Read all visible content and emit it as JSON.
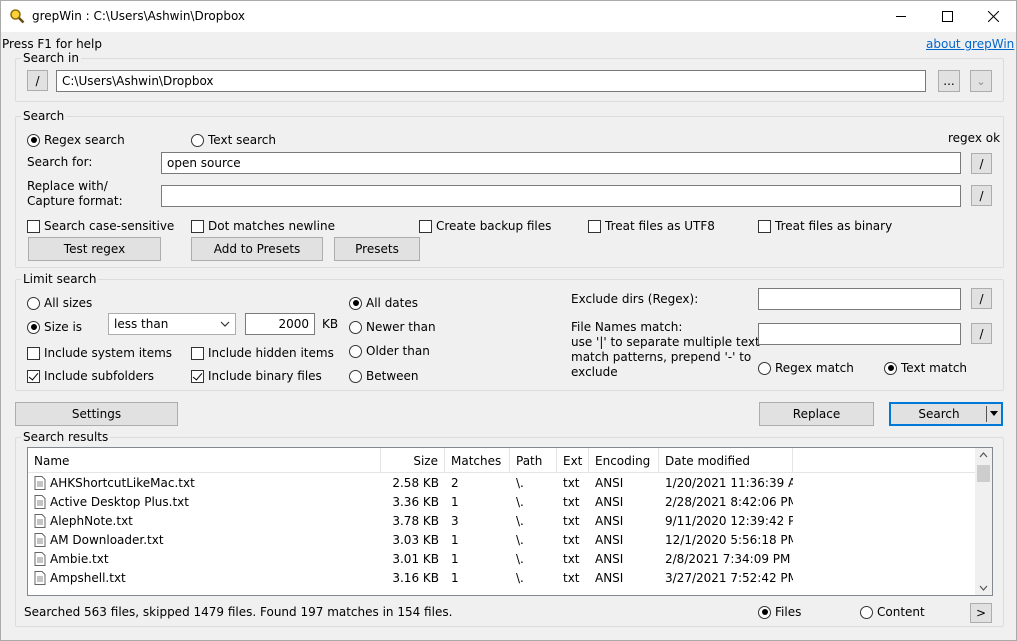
{
  "window": {
    "title": "grepWin : C:\\Users\\Ashwin\\Dropbox",
    "help": "Press F1 for help",
    "about_link": "about grepWin"
  },
  "search_in": {
    "legend": "Search in",
    "slash": "/",
    "path": "C:\\Users\\Ashwin\\Dropbox",
    "browse": "...",
    "dropdown": "⌄"
  },
  "search": {
    "legend": "Search",
    "regex_search": "Regex search",
    "text_search": "Text search",
    "status": "regex ok",
    "search_for_label": "Search for:",
    "search_for_value": "open source",
    "replace_label_1": "Replace with/",
    "replace_label_2": "Capture format:",
    "replace_value": "",
    "slash": "/",
    "case_sensitive": "Search case-sensitive",
    "dot_newline": "Dot matches newline",
    "backup_files": "Create backup files",
    "utf8": "Treat files as UTF8",
    "binary": "Treat files as binary",
    "test_regex": "Test regex",
    "add_presets": "Add to Presets",
    "presets": "Presets"
  },
  "limit": {
    "legend": "Limit search",
    "all_sizes": "All sizes",
    "size_is": "Size is",
    "size_op": "less than",
    "size_value": "2000",
    "size_unit": "KB",
    "include_system": "Include system items",
    "include_hidden": "Include hidden items",
    "include_subfolders": "Include subfolders",
    "include_binary": "Include binary files",
    "all_dates": "All dates",
    "newer_than": "Newer than",
    "older_than": "Older than",
    "between": "Between",
    "exclude_dirs_label": "Exclude dirs (Regex):",
    "exclude_dirs_value": "",
    "file_names_label_1": "File Names match:",
    "file_names_label_2": "use '|' to separate multiple text",
    "file_names_label_3": "match patterns, prepend '-' to",
    "file_names_label_4": "exclude",
    "file_names_value": "",
    "regex_match": "Regex match",
    "text_match": "Text match",
    "slash": "/"
  },
  "actions": {
    "settings": "Settings",
    "replace": "Replace",
    "search": "Search"
  },
  "results": {
    "legend": "Search results",
    "columns": [
      "Name",
      "Size",
      "Matches",
      "Path",
      "Ext",
      "Encoding",
      "Date modified"
    ],
    "rows": [
      {
        "name": "AHKShortcutLikeMac.txt",
        "size": "2.58 KB",
        "matches": "2",
        "path": "\\.",
        "ext": "txt",
        "encoding": "ANSI",
        "date": "1/20/2021 11:36:39 AM"
      },
      {
        "name": "Active Desktop Plus.txt",
        "size": "3.36 KB",
        "matches": "1",
        "path": "\\.",
        "ext": "txt",
        "encoding": "ANSI",
        "date": "2/28/2021 8:42:06 PM"
      },
      {
        "name": "AlephNote.txt",
        "size": "3.78 KB",
        "matches": "3",
        "path": "\\.",
        "ext": "txt",
        "encoding": "ANSI",
        "date": "9/11/2020 12:39:42 PM"
      },
      {
        "name": "AM Downloader.txt",
        "size": "3.03 KB",
        "matches": "1",
        "path": "\\.",
        "ext": "txt",
        "encoding": "ANSI",
        "date": "12/1/2020 5:56:18 PM"
      },
      {
        "name": "Ambie.txt",
        "size": "3.01 KB",
        "matches": "1",
        "path": "\\.",
        "ext": "txt",
        "encoding": "ANSI",
        "date": "2/8/2021 7:34:09 PM"
      },
      {
        "name": "Ampshell.txt",
        "size": "3.16 KB",
        "matches": "1",
        "path": "\\.",
        "ext": "txt",
        "encoding": "ANSI",
        "date": "3/27/2021 7:52:42 PM"
      }
    ]
  },
  "status": {
    "text": "Searched 563 files, skipped 1479 files. Found 197 matches in 154 files.",
    "files": "Files",
    "content": "Content",
    "next": ">"
  }
}
